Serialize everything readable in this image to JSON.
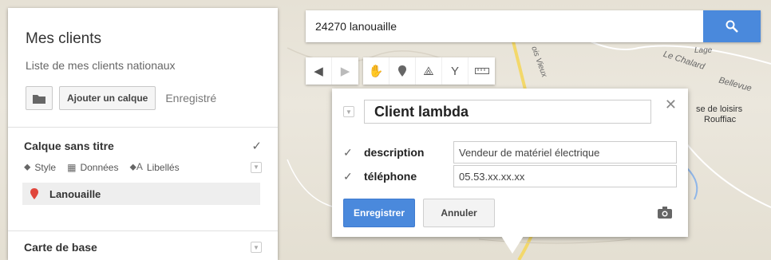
{
  "panel": {
    "title": "Mes clients",
    "subtitle": "Liste de mes clients nationaux",
    "add_layer_label": "Ajouter un calque",
    "saved_label": "Enregistré"
  },
  "layer": {
    "title": "Calque sans titre",
    "tools": {
      "style": "Style",
      "data": "Données",
      "labels": "Libellés"
    },
    "place": "Lanouaille"
  },
  "base_map": {
    "title": "Carte de base"
  },
  "search": {
    "value": "24270 lanouaille"
  },
  "map_labels": {
    "chalard": "Le Chalard",
    "bellevue": "Bellevue",
    "lage": "Lage",
    "poi": "se de loisirs",
    "poi2": "Rouffiac",
    "road": "ois Vieux"
  },
  "popup": {
    "title": "Client lambda",
    "fields": [
      {
        "label": "description",
        "value": "Vendeur de matériel électrique"
      },
      {
        "label": "téléphone",
        "value": "05.53.xx.xx.xx"
      }
    ],
    "save_label": "Enregistrer",
    "cancel_label": "Annuler"
  },
  "colors": {
    "accent": "#4a89dc",
    "pin": "#e0463c"
  }
}
